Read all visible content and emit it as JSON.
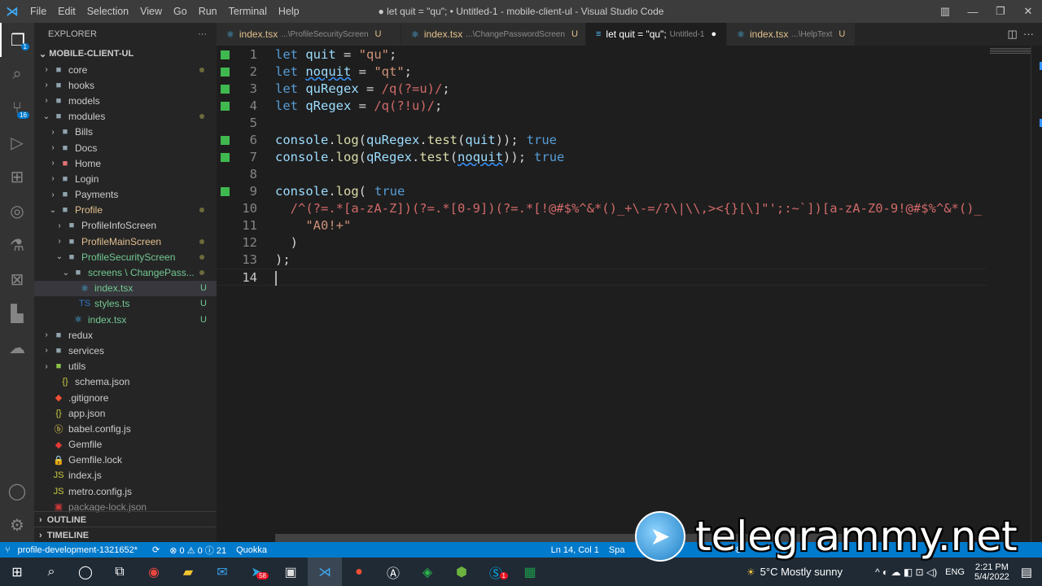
{
  "titlebar": {
    "menu": [
      "File",
      "Edit",
      "Selection",
      "View",
      "Go",
      "Run",
      "Terminal",
      "Help"
    ],
    "title": "● let quit = \"qu\"; • Untitled-1 - mobile-client-ul - Visual Studio Code"
  },
  "activity": {
    "scm_badge": "16",
    "explorer_badge": "1"
  },
  "sidebar": {
    "header": "EXPLORER",
    "more": "···",
    "root": "MOBILE-CLIENT-UL",
    "outline": "OUTLINE",
    "timeline": "TIMELINE",
    "items": [
      {
        "label": "core",
        "indent": 1,
        "kind": "folder",
        "chev": "›",
        "dot": true
      },
      {
        "label": "hooks",
        "indent": 1,
        "kind": "folder",
        "chev": "›"
      },
      {
        "label": "models",
        "indent": 1,
        "kind": "folder",
        "chev": "›"
      },
      {
        "label": "modules",
        "indent": 1,
        "kind": "folder",
        "chev": "⌄",
        "dot": true
      },
      {
        "label": "Bills",
        "indent": 2,
        "kind": "folder",
        "chev": "›"
      },
      {
        "label": "Docs",
        "indent": 2,
        "kind": "folder",
        "chev": "›"
      },
      {
        "label": "Home",
        "indent": 2,
        "kind": "folder-red",
        "chev": "›"
      },
      {
        "label": "Login",
        "indent": 2,
        "kind": "folder",
        "chev": "›"
      },
      {
        "label": "Payments",
        "indent": 2,
        "kind": "folder",
        "chev": "›"
      },
      {
        "label": "Profile",
        "indent": 2,
        "kind": "folder",
        "chev": "⌄",
        "dot": true,
        "color": "#e2c08d"
      },
      {
        "label": "ProfileInfoScreen",
        "indent": 3,
        "kind": "folder",
        "chev": "›"
      },
      {
        "label": "ProfileMainScreen",
        "indent": 3,
        "kind": "folder",
        "chev": "›",
        "dot": true,
        "color": "#e2c08d"
      },
      {
        "label": "ProfileSecurityScreen",
        "indent": 3,
        "kind": "folder",
        "chev": "⌄",
        "dot": true,
        "color": "#73c991"
      },
      {
        "label": "screens \\ ChangePass...",
        "indent": 4,
        "kind": "folder",
        "chev": "⌄",
        "dot": true,
        "color": "#73c991"
      },
      {
        "label": "index.tsx",
        "indent": 5,
        "kind": "react",
        "status": "U",
        "color": "#73c991",
        "selected": true
      },
      {
        "label": "styles.ts",
        "indent": 5,
        "kind": "ts",
        "status": "U",
        "color": "#73c991"
      },
      {
        "label": "index.tsx",
        "indent": 4,
        "kind": "react",
        "status": "U",
        "color": "#73c991"
      },
      {
        "label": "redux",
        "indent": 1,
        "kind": "folder",
        "chev": "›"
      },
      {
        "label": "services",
        "indent": 1,
        "kind": "folder",
        "chev": "›"
      },
      {
        "label": "utils",
        "indent": 1,
        "kind": "folder-green",
        "chev": "›"
      },
      {
        "label": "schema.json",
        "indent": 2,
        "kind": "json"
      },
      {
        "label": ".gitignore",
        "indent": 1,
        "kind": "git"
      },
      {
        "label": "app.json",
        "indent": 1,
        "kind": "json"
      },
      {
        "label": "babel.config.js",
        "indent": 1,
        "kind": "babel"
      },
      {
        "label": "Gemfile",
        "indent": 1,
        "kind": "ruby"
      },
      {
        "label": "Gemfile.lock",
        "indent": 1,
        "kind": "lock"
      },
      {
        "label": "index.js",
        "indent": 1,
        "kind": "js"
      },
      {
        "label": "metro.config.js",
        "indent": 1,
        "kind": "js"
      },
      {
        "label": "package-lock.json",
        "indent": 1,
        "kind": "npm"
      }
    ]
  },
  "tabs": [
    {
      "name": "index.tsx",
      "path": "...\\ProfileSecurityScreen",
      "mark": "U"
    },
    {
      "name": "index.tsx",
      "path": "...\\ChangePasswordScreen",
      "mark": "U"
    },
    {
      "name": "let quit = \"qu\";",
      "path": "Untitled-1",
      "mark": "●",
      "active": true
    },
    {
      "name": "index.tsx",
      "path": "...\\HelpText",
      "mark": "U"
    }
  ],
  "code": [
    [
      [
        "let ",
        "k"
      ],
      [
        "quit",
        "v"
      ],
      [
        " = ",
        ""
      ],
      [
        "\"qu\"",
        "s"
      ],
      [
        ";",
        ""
      ]
    ],
    [
      [
        "let ",
        "k"
      ],
      [
        "noquit",
        "v sq"
      ],
      [
        " = ",
        ""
      ],
      [
        "\"qt\"",
        "s"
      ],
      [
        ";",
        ""
      ]
    ],
    [
      [
        "let ",
        "k"
      ],
      [
        "quRegex",
        "v"
      ],
      [
        " = ",
        ""
      ],
      [
        "/q(?=u)/",
        "r"
      ],
      [
        ";",
        ""
      ]
    ],
    [
      [
        "let ",
        "k"
      ],
      [
        "qRegex",
        "v"
      ],
      [
        " = ",
        ""
      ],
      [
        "/q(?!u)/",
        "r"
      ],
      [
        ";",
        ""
      ]
    ],
    [],
    [
      [
        "console",
        "v"
      ],
      [
        ".",
        ""
      ],
      [
        "log",
        "f"
      ],
      [
        "(",
        ""
      ],
      [
        "quRegex",
        "v"
      ],
      [
        ".",
        ""
      ],
      [
        "test",
        "f"
      ],
      [
        "(",
        ""
      ],
      [
        "quit",
        "v"
      ],
      [
        "));",
        ""
      ],
      [
        "true",
        "q"
      ]
    ],
    [
      [
        "console",
        "v"
      ],
      [
        ".",
        ""
      ],
      [
        "log",
        "f"
      ],
      [
        "(",
        ""
      ],
      [
        "qRegex",
        "v"
      ],
      [
        ".",
        ""
      ],
      [
        "test",
        "f"
      ],
      [
        "(",
        ""
      ],
      [
        "noquit",
        "v sq"
      ],
      [
        "));",
        ""
      ],
      [
        "true",
        "q"
      ]
    ],
    [],
    [
      [
        "console",
        "v"
      ],
      [
        ".",
        ""
      ],
      [
        "log",
        "f"
      ],
      [
        "(",
        ""
      ],
      [
        "true",
        "q"
      ]
    ],
    [
      [
        "  /^(?=.*[a-zA-Z])(?=.*[0-9])(?=.*[!@#$%^&*()_+\\-=/?\\|\\\\,><{}[\\]\"';:~`])[a-zA-Z0-9!@#$%^&*()_",
        "r"
      ]
    ],
    [
      [
        "    ",
        ""
      ],
      [
        "\"A0!+\"",
        "s"
      ]
    ],
    [
      [
        "  )",
        ""
      ]
    ],
    [
      [
        ");",
        ""
      ]
    ],
    []
  ],
  "gutter_marks": [
    1,
    2,
    3,
    4,
    6,
    7,
    9
  ],
  "current_line": 14,
  "status": {
    "branch": "profile-development-1321652*",
    "sync": "⟳",
    "problems": "⊗ 0 ⚠ 0 ⓘ 21",
    "quokka": "Quokka",
    "position": "Ln 14, Col 1",
    "spaces": "Spa",
    "encoding": "F-8"
  },
  "taskbar": {
    "weather": "5°C  Mostly sunny",
    "lang": "ENG",
    "time": "2:21 PM",
    "date": "5/4/2022",
    "telegram_badge": "58",
    "skype_badge": "1"
  },
  "watermark": "telegrammy.net"
}
